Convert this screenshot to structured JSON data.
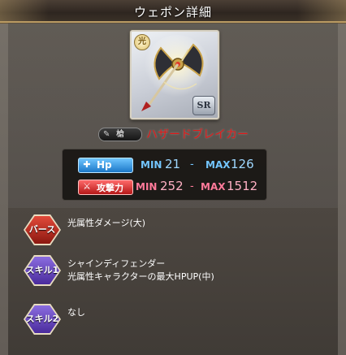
{
  "window": {
    "title": "ウェポン詳細"
  },
  "weapon": {
    "element_badge": "光",
    "rarity": "SR",
    "type_label": "槍",
    "name": "ハザードブレイカー"
  },
  "stats": {
    "hp": {
      "label": "Hp",
      "min_label": "MIN",
      "min": "21",
      "sep": "-",
      "max_label": "MAX",
      "max": "126"
    },
    "atk": {
      "label": "攻撃力",
      "min_label": "MIN",
      "min": "252",
      "sep": "-",
      "max_label": "MAX",
      "max": "1512"
    }
  },
  "skills": [
    {
      "badge": "バースト",
      "kind": "burst",
      "name": "光属性ダメージ(大)",
      "desc": ""
    },
    {
      "badge": "スキル1",
      "kind": "skill",
      "name": "シャインディフェンダー",
      "desc": "光属性キャラクターの最大HPUP(中)"
    },
    {
      "badge": "スキル2",
      "kind": "skill",
      "name": "なし",
      "desc": ""
    }
  ],
  "colors": {
    "weapon_name": "#e01818",
    "hp_accent": "#1c78c8",
    "atk_accent": "#b51818",
    "burst_badge": "#8c1810",
    "skill_badge": "#4a2b9c"
  }
}
